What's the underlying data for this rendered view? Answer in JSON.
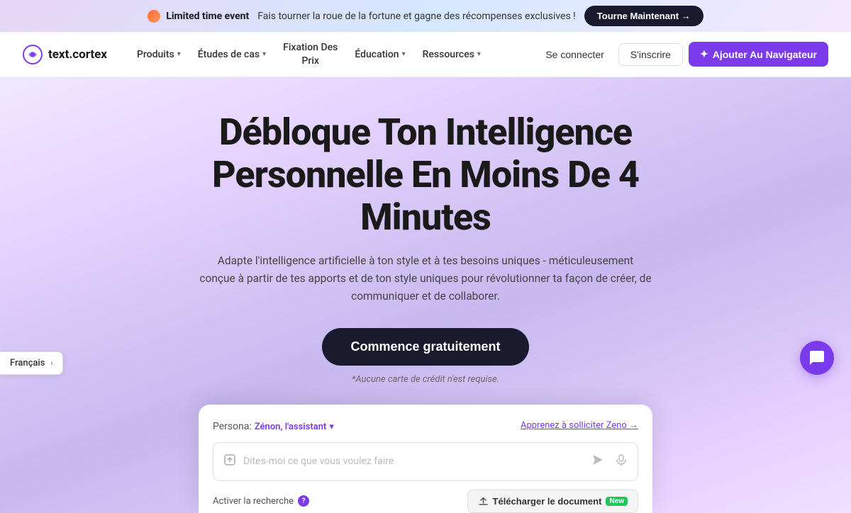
{
  "banner": {
    "event_label": "Limited time event",
    "text": "Fais tourner la roue de la fortune et gagne des récompenses exclusives !",
    "button_label": "Tourne Maintenant →"
  },
  "navbar": {
    "logo_text": "text.cortex",
    "nav_items": [
      {
        "label": "Produits",
        "has_dropdown": true
      },
      {
        "label": "Études de cas",
        "has_dropdown": true
      },
      {
        "label": "Fixation Des Prix",
        "has_dropdown": false,
        "multiline": true
      },
      {
        "label": "Éducation",
        "has_dropdown": true
      },
      {
        "label": "Ressources",
        "has_dropdown": true
      }
    ],
    "signin_label": "Se connecter",
    "signup_label": "S'inscrire",
    "add_nav_label": "Ajouter Au Navigateur"
  },
  "hero": {
    "title": "Débloque Ton Intelligence Personnelle En Moins De 4 Minutes",
    "subtitle": "Adapte l'intelligence artificielle à ton style et à tes besoins uniques - méticuleusement conçue à partir de tes apports et de ton style uniques pour révolutionner ta façon de créer, de communiquer et de collaborer.",
    "cta_button": "Commence gratuitement",
    "no_card_note": "*Aucune carte de crédit n'est requise."
  },
  "chat_widget": {
    "persona_prefix": "Persona:",
    "persona_name": "Zénon, l'assistant",
    "learn_link": "Apprenez à solliciter Zeno →",
    "input_placeholder": "Dites-moi ce que vous voulez faire",
    "search_toggle_label": "Activer la recherche",
    "upload_doc_label": "Télécharger le document",
    "new_badge": "New"
  },
  "language": {
    "current": "Français",
    "chevron": "›"
  },
  "icons": {
    "timer": "⏱",
    "spark": "✦",
    "chevron_down": "▾",
    "chevron_right": "›",
    "upload": "⬆",
    "send": "➤",
    "mic": "🎤",
    "chat": "💬",
    "help": "?"
  }
}
